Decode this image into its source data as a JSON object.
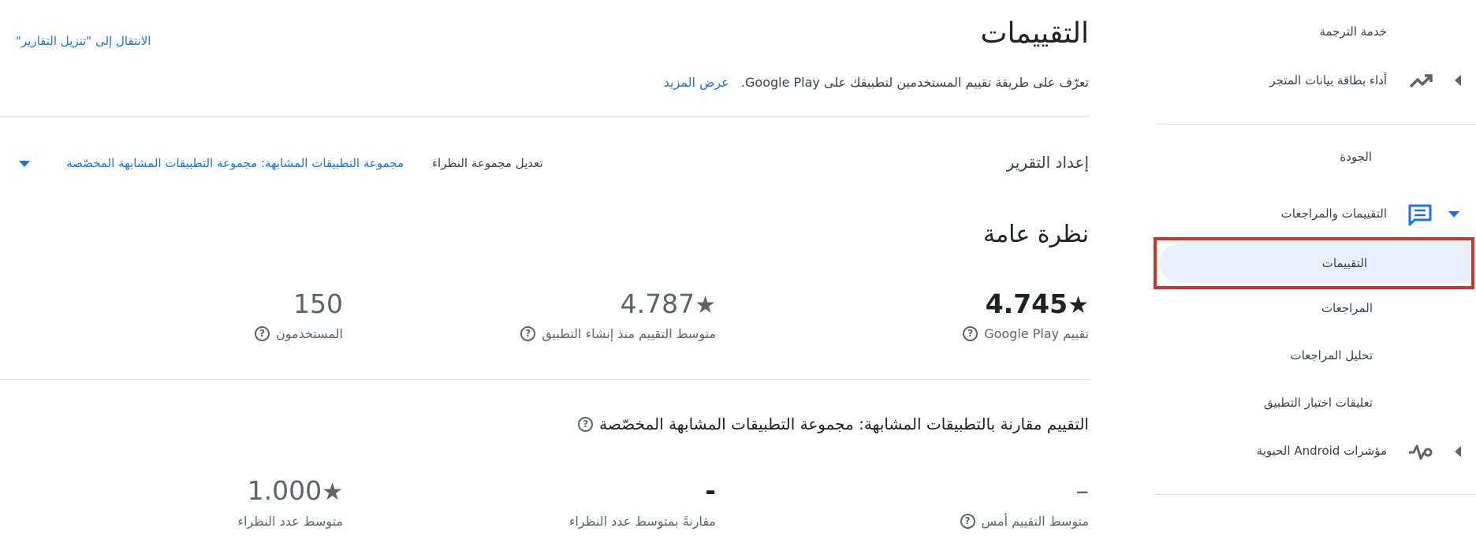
{
  "sidebar": {
    "translation_service": "خدمة الترجمة",
    "store_listing_performance": "أداء بطاقة بيانات المتجر",
    "quality_heading": "الجودة",
    "ratings_and_reviews": "التقييمات والمراجعات",
    "ratings": "التقييمات",
    "reviews": "المراجعات",
    "reviews_analysis": "تحليل المراجعات",
    "testing_feedback": "تعليقات اختبار التطبيق",
    "android_vitals": "مؤشرات Android الحيوية"
  },
  "header": {
    "title": "التقييمات",
    "goto_reports_link": "الانتقال إلى \"تنزيل التقارير\"",
    "description": "تعرّف على طريقة تقييم المستخدمين لتطبيقك على Google Play.",
    "learn_more": "عرض المزيد"
  },
  "report_setup": {
    "label": "إعداد التقرير",
    "edit_peer_group": "تعديل مجموعة النظراء",
    "peer_group_select": "مجموعة التطبيقات المشابهة: مجموعة التطبيقات المشابهة المخصّصة"
  },
  "overview": {
    "title": "نظرة عامة",
    "metrics": [
      {
        "value": "4.745",
        "label": "تقييم Google Play"
      },
      {
        "value": "4.787",
        "label": "متوسط التقييم منذ إنشاء التطبيق"
      },
      {
        "value": "150",
        "label": "المستخدمون"
      }
    ]
  },
  "comparison": {
    "title": "التقييم مقارنة بالتطبيقات المشابهة: مجموعة التطبيقات المشابهة المخصّصة",
    "metrics": [
      {
        "value": "–",
        "label": "متوسط التقييم أمس"
      },
      {
        "value": "-",
        "label": "مقارنةً بمتوسط عدد النظراء"
      },
      {
        "value": "1.000",
        "label": "متوسط عدد النظراء"
      }
    ]
  },
  "icons": {
    "star": "★",
    "help": "?"
  },
  "colors": {
    "accent": "#1a73e8",
    "selected_bg": "#e8f0fe",
    "highlight_border": "#d93025"
  }
}
